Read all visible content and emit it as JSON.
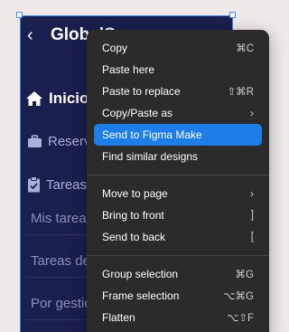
{
  "canvas": {
    "frame": {
      "title": "GlobalS",
      "back_glyph": "‹",
      "home_label": "Inicio",
      "sections": [
        {
          "label": "Reserva",
          "icon": "briefcase-icon"
        },
        {
          "label": "Tareas",
          "icon": "clipboard-check-icon"
        }
      ],
      "items": [
        "Mis tareas",
        "Tareas de",
        "Por gestio"
      ]
    }
  },
  "context_menu": {
    "groups": [
      [
        {
          "label": "Copy",
          "shortcut": "⌘C"
        },
        {
          "label": "Paste here",
          "shortcut": ""
        },
        {
          "label": "Paste to replace",
          "shortcut": "⇧⌘R"
        },
        {
          "label": "Copy/Paste as",
          "shortcut": "",
          "submenu": true
        },
        {
          "label": "Send to Figma Make",
          "shortcut": "",
          "highlighted": true
        },
        {
          "label": "Find similar designs",
          "shortcut": ""
        }
      ],
      [
        {
          "label": "Move to page",
          "shortcut": "",
          "submenu": true
        },
        {
          "label": "Bring to front",
          "shortcut": "]"
        },
        {
          "label": "Send to back",
          "shortcut": "["
        }
      ],
      [
        {
          "label": "Group selection",
          "shortcut": "⌘G"
        },
        {
          "label": "Frame selection",
          "shortcut": "⌥⌘G"
        },
        {
          "label": "Flatten",
          "shortcut": "⌥⇧F"
        }
      ]
    ],
    "submenu_glyph": "›",
    "highlight_color": "#1e7ee8"
  }
}
